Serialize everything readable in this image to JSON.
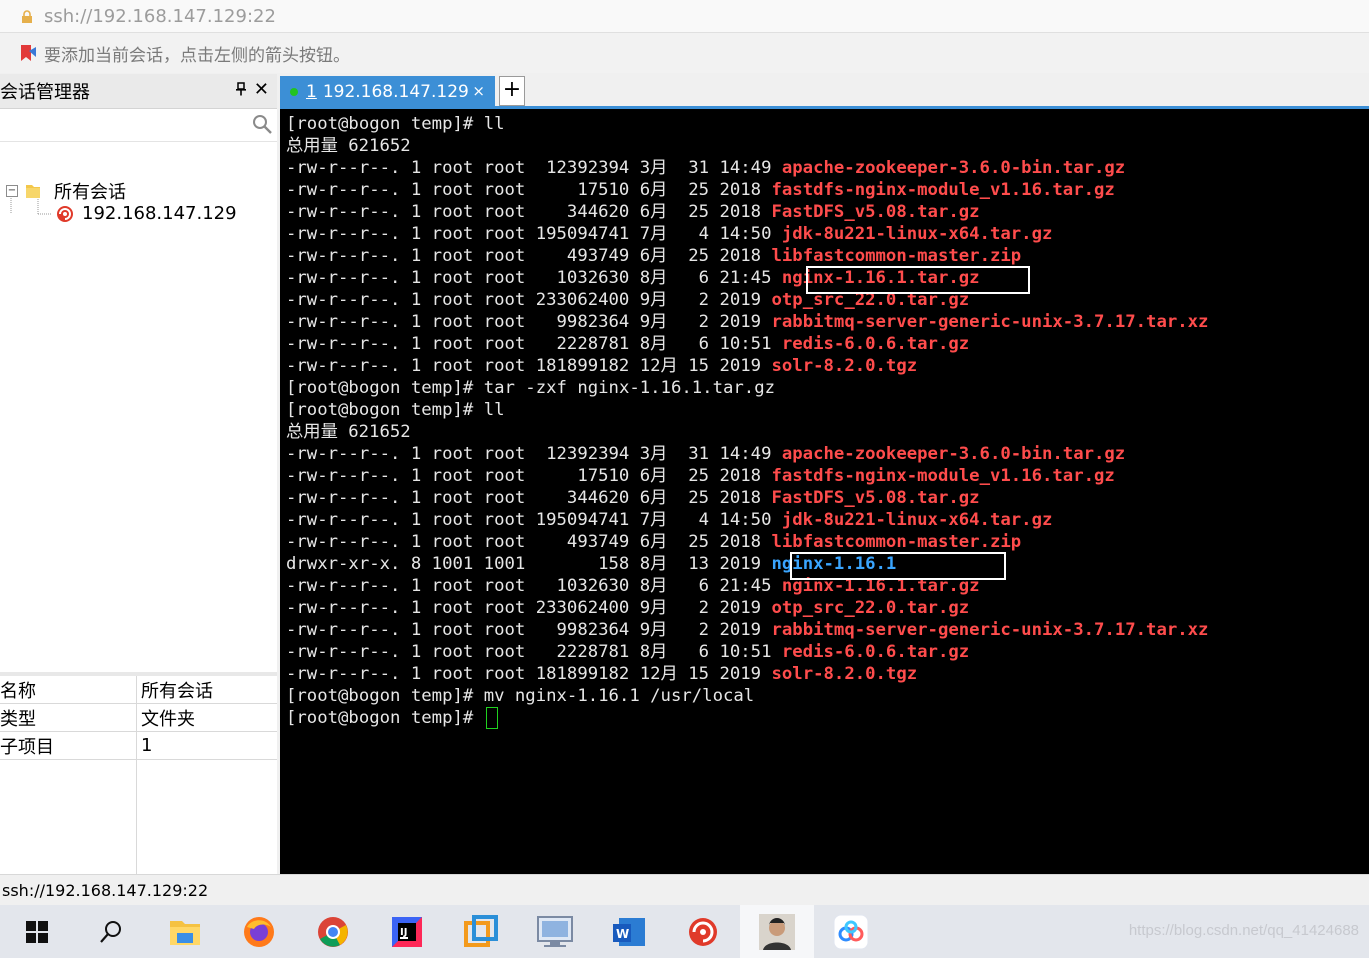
{
  "address_bar": {
    "url": "ssh://192.168.147.129:22"
  },
  "hint_bar": {
    "text": "要添加当前会话，点击左侧的箭头按钮。"
  },
  "session_manager": {
    "title": "会话管理器",
    "tree": {
      "root_label": "所有会话",
      "root_expander": "−",
      "child_label": "192.168.147.129"
    },
    "properties": [
      {
        "key": "名称",
        "value": "所有会话"
      },
      {
        "key": "类型",
        "value": "文件夹"
      },
      {
        "key": "子项目",
        "value": "1"
      }
    ]
  },
  "tab": {
    "number": "1",
    "label": "192.168.147.129",
    "close": "×",
    "new_tab": "+"
  },
  "terminal": {
    "prompt": "[root@bogon temp]# ",
    "cmd1": "ll",
    "total1": "总用量 621652",
    "listing1": [
      {
        "meta": "-rw-r--r--. 1 root root  12392394 3月  31 14:49 ",
        "name": "apache-zookeeper-3.6.0-bin.tar.gz"
      },
      {
        "meta": "-rw-r--r--. 1 root root     17510 6月  25 2018 ",
        "name": "fastdfs-nginx-module_v1.16.tar.gz"
      },
      {
        "meta": "-rw-r--r--. 1 root root    344620 6月  25 2018 ",
        "name": "FastDFS_v5.08.tar.gz"
      },
      {
        "meta": "-rw-r--r--. 1 root root 195094741 7月   4 14:50 ",
        "name": "jdk-8u221-linux-x64.tar.gz"
      },
      {
        "meta": "-rw-r--r--. 1 root root    493749 6月  25 2018 ",
        "name": "libfastcommon-master.zip"
      },
      {
        "meta": "-rw-r--r--. 1 root root   1032630 8月   6 21:45 ",
        "name": "nginx-1.16.1.tar.gz"
      },
      {
        "meta": "-rw-r--r--. 1 root root 233062400 9月   2 2019 ",
        "name": "otp_src_22.0.tar.gz"
      },
      {
        "meta": "-rw-r--r--. 1 root root   9982364 9月   2 2019 ",
        "name": "rabbitmq-server-generic-unix-3.7.17.tar.xz"
      },
      {
        "meta": "-rw-r--r--. 1 root root   2228781 8月   6 10:51 ",
        "name": "redis-6.0.6.tar.gz"
      },
      {
        "meta": "-rw-r--r--. 1 root root 181899182 12月 15 2019 ",
        "name": "solr-8.2.0.tgz"
      }
    ],
    "cmd2": "tar -zxf nginx-1.16.1.tar.gz",
    "cmd3": "ll",
    "total2": "总用量 621652",
    "listing2": [
      {
        "meta": "-rw-r--r--. 1 root root  12392394 3月  31 14:49 ",
        "name": "apache-zookeeper-3.6.0-bin.tar.gz",
        "kind": "file"
      },
      {
        "meta": "-rw-r--r--. 1 root root     17510 6月  25 2018 ",
        "name": "fastdfs-nginx-module_v1.16.tar.gz",
        "kind": "file"
      },
      {
        "meta": "-rw-r--r--. 1 root root    344620 6月  25 2018 ",
        "name": "FastDFS_v5.08.tar.gz",
        "kind": "file"
      },
      {
        "meta": "-rw-r--r--. 1 root root 195094741 7月   4 14:50 ",
        "name": "jdk-8u221-linux-x64.tar.gz",
        "kind": "file"
      },
      {
        "meta": "-rw-r--r--. 1 root root    493749 6月  25 2018 ",
        "name": "libfastcommon-master.zip",
        "kind": "file"
      },
      {
        "meta": "drwxr-xr-x. 8 1001 1001       158 8月  13 2019 ",
        "name": "nginx-1.16.1",
        "kind": "dir"
      },
      {
        "meta": "-rw-r--r--. 1 root root   1032630 8月   6 21:45 ",
        "name": "nginx-1.16.1.tar.gz",
        "kind": "file"
      },
      {
        "meta": "-rw-r--r--. 1 root root 233062400 9月   2 2019 ",
        "name": "otp_src_22.0.tar.gz",
        "kind": "file"
      },
      {
        "meta": "-rw-r--r--. 1 root root   9982364 9月   2 2019 ",
        "name": "rabbitmq-server-generic-unix-3.7.17.tar.xz",
        "kind": "file"
      },
      {
        "meta": "-rw-r--r--. 1 root root   2228781 8月   6 10:51 ",
        "name": "redis-6.0.6.tar.gz",
        "kind": "file"
      },
      {
        "meta": "-rw-r--r--. 1 root root 181899182 12月 15 2019 ",
        "name": "solr-8.2.0.tgz",
        "kind": "file"
      }
    ],
    "cmd4": "mv nginx-1.16.1 /usr/local",
    "colors": {
      "file": "#ff4c4c",
      "dir": "#3aa5ff",
      "text": "#e6e6e6",
      "cursor": "#1fd21f"
    }
  },
  "status_bar": {
    "text": "ssh://192.168.147.129:22"
  },
  "taskbar": {
    "items": [
      "start-icon",
      "search-icon",
      "file-explorer-icon",
      "firefox-icon",
      "chrome-icon",
      "intellij-icon",
      "vmware-icon",
      "remote-desktop-icon",
      "word-icon",
      "xshell-icon",
      "user-avatar-icon",
      "baidu-netdisk-icon"
    ],
    "watermark": "https://blog.csdn.net/qq_41424688"
  }
}
